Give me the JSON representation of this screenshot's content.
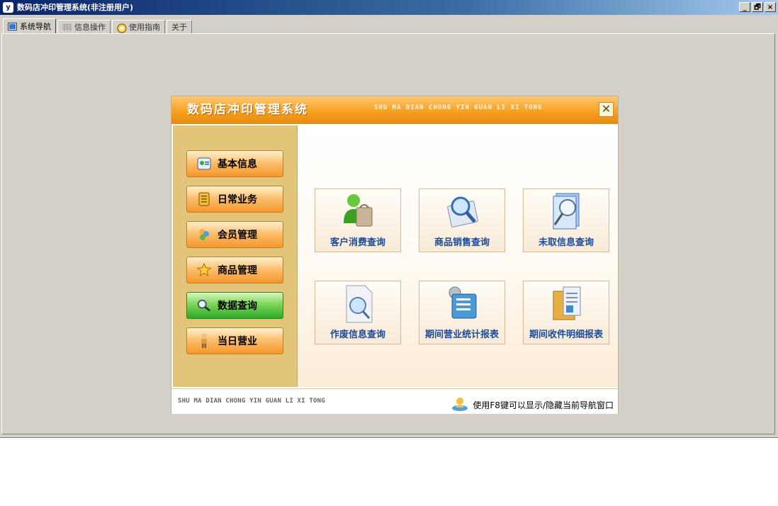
{
  "window": {
    "title": "数码店冲印管理系统(非注册用户)",
    "app_icon": "y",
    "buttons": {
      "minimize": "_",
      "restore": "🗗",
      "close": "×"
    }
  },
  "tabs": [
    {
      "label": "系统导航",
      "icon": "window-icon",
      "active": true
    },
    {
      "label": "信息操作",
      "icon": "grid-icon",
      "active": false
    },
    {
      "label": "使用指南",
      "icon": "help-icon",
      "active": false
    },
    {
      "label": "关于",
      "icon": "",
      "active": false
    }
  ],
  "panel": {
    "title": "数码店冲印管理系统",
    "pinyin": "SHU MA DIAN CHONG YIN GUAN LI XI TONG",
    "close_label": "✕",
    "side_buttons": [
      {
        "label": "基本信息",
        "icon": "contact-card-icon"
      },
      {
        "label": "日常业务",
        "icon": "notebook-icon"
      },
      {
        "label": "会员管理",
        "icon": "members-icon"
      },
      {
        "label": "商品管理",
        "icon": "star-icon"
      },
      {
        "label": "数据查询",
        "icon": "magnifier-icon",
        "active": true
      },
      {
        "label": "当日营业",
        "icon": "person-icon"
      }
    ],
    "query_buttons": [
      {
        "label": "客户消费查询",
        "icon": "customer-bag-icon"
      },
      {
        "label": "商品销售查询",
        "icon": "product-search-icon"
      },
      {
        "label": "未取信息查询",
        "icon": "document-search-icon"
      },
      {
        "label": "作废信息查询",
        "icon": "void-doc-search-icon"
      },
      {
        "label": "期间营业统计报表",
        "icon": "report-gear-icon"
      },
      {
        "label": "期间收件明细报表",
        "icon": "folder-report-icon"
      }
    ],
    "footer_en": "SHU MA DIAN CHONG YIN GUAN LI XI TONG",
    "footer_hint": "使用F8键可以显示/隐藏当前导航窗口"
  },
  "colors": {
    "accent_orange": "#f6a020",
    "active_green": "#2ea82a",
    "label_blue": "#1a4a9a"
  }
}
